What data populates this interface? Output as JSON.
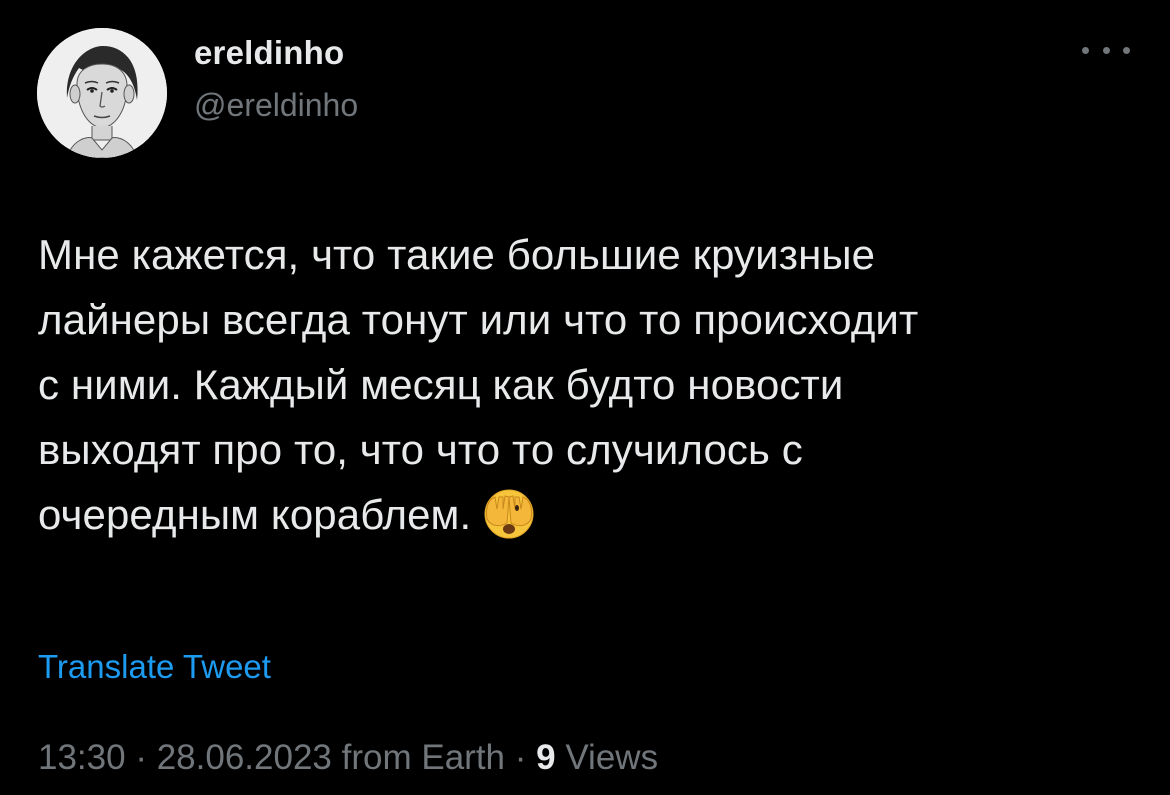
{
  "author": {
    "display_name": "ereldinho",
    "handle": "@ereldinho",
    "avatar_icon": "avatar-portrait"
  },
  "more_icon": "ellipsis-icon",
  "tweet": {
    "lines": [
      "Мне кажется, что такие большие круизные",
      "лайнеры всегда тонут или что то происходит",
      "с ними. Каждый месяц как будто новости",
      "выходят про то, что что то случилось с",
      "очередным кораблем."
    ],
    "emoji": "face-with-hand-over-eyes-emoji"
  },
  "translate_label": "Translate Tweet",
  "meta": {
    "time": "13:30",
    "date": "28.06.2023",
    "source": "from Earth",
    "separator": "·",
    "views_count": "9",
    "views_label": "Views"
  },
  "colors": {
    "background": "#000000",
    "primary_text": "#e7e9ea",
    "secondary_text": "#71767b",
    "link": "#1d9bf0"
  }
}
